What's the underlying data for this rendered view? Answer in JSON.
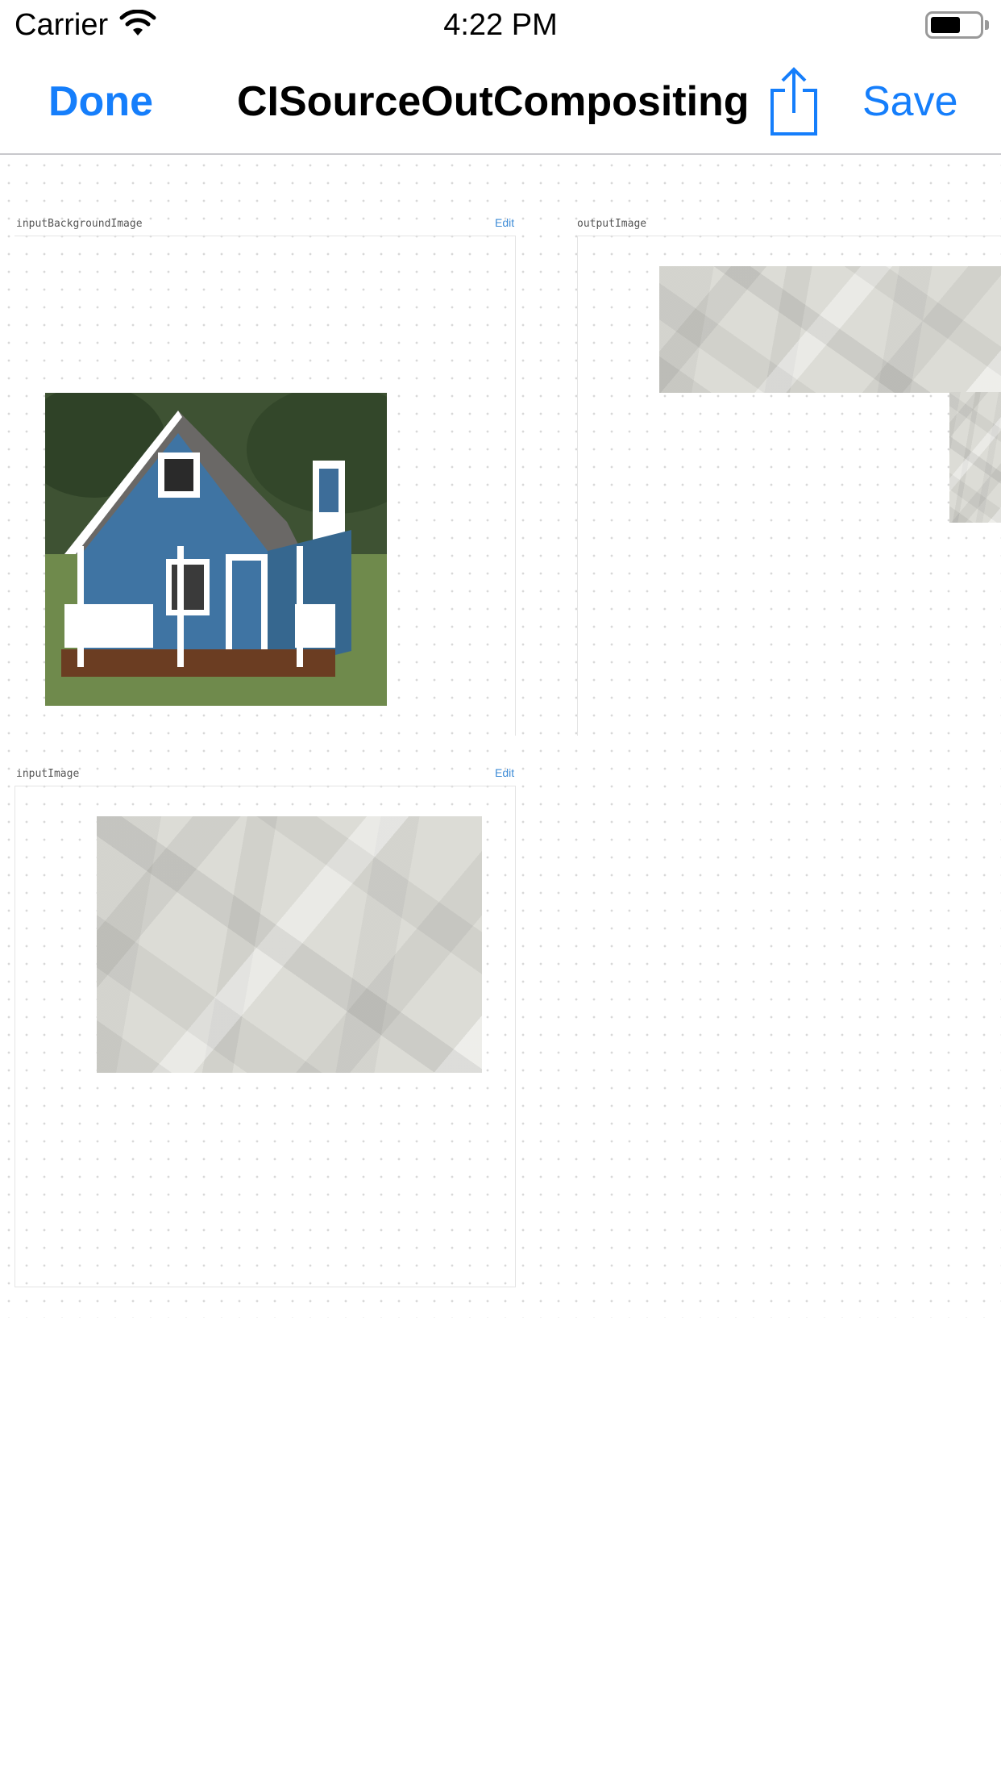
{
  "status_bar": {
    "carrier": "Carrier",
    "time": "4:22 PM",
    "icons": [
      "wifi-icon",
      "battery-icon"
    ]
  },
  "nav_bar": {
    "done_label": "Done",
    "title": "CISourceOutCompositing",
    "share_icon": "share-icon",
    "save_label": "Save",
    "accent_color": "#157efb"
  },
  "panels": {
    "background_image": {
      "label": "inputBackgroundImage",
      "edit_label": "Edit"
    },
    "output_image": {
      "label": "outputImage"
    },
    "input_image": {
      "label": "inputImage",
      "edit_label": "Edit"
    }
  }
}
